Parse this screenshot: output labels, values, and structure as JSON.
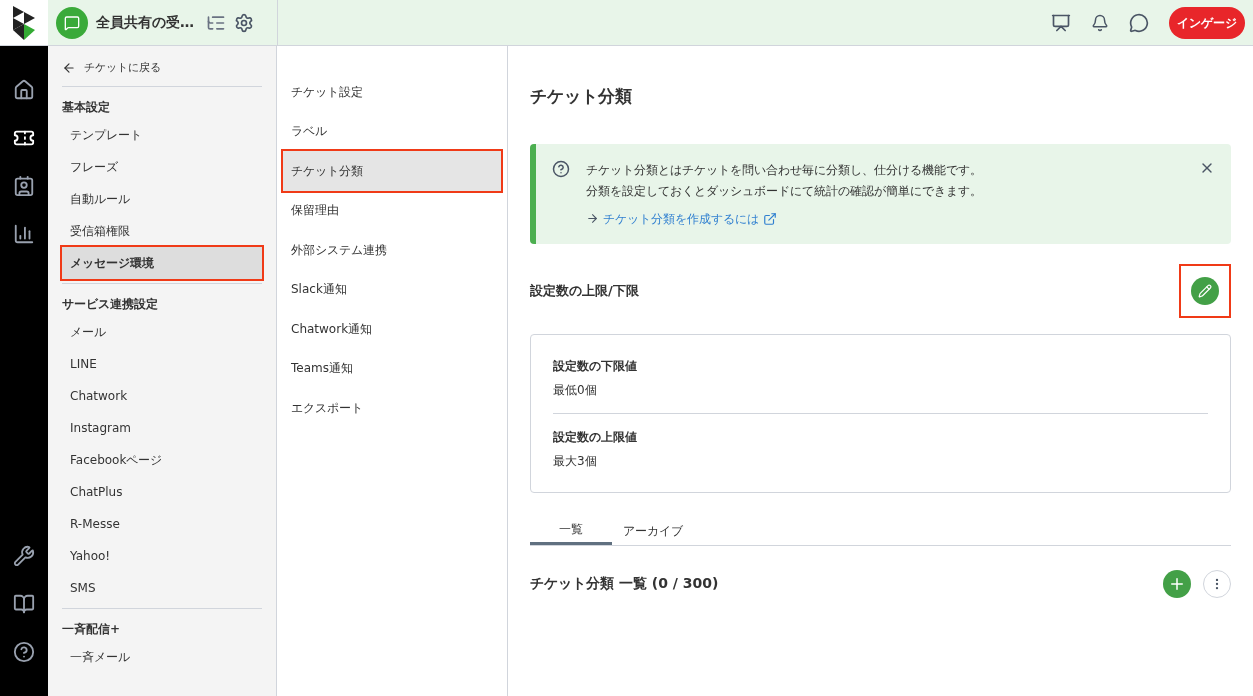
{
  "header": {
    "inbox_name": "全員共有の受…",
    "avatar": "インゲージ"
  },
  "rail": {
    "top": [
      {
        "kind": "home",
        "selected": false
      },
      {
        "kind": "ticket",
        "selected": true
      },
      {
        "kind": "contacts",
        "selected": false
      },
      {
        "kind": "stats",
        "selected": false
      }
    ],
    "bottom": [
      {
        "kind": "tools"
      },
      {
        "kind": "book"
      },
      {
        "kind": "help"
      }
    ]
  },
  "sidebar": {
    "back": "チケットに戻る",
    "sections": [
      {
        "title": "基本設定",
        "items": [
          {
            "label": "テンプレート",
            "selected": false,
            "highlighted": false
          },
          {
            "label": "フレーズ",
            "selected": false,
            "highlighted": false
          },
          {
            "label": "自動ルール",
            "selected": false,
            "highlighted": false
          },
          {
            "label": "受信箱権限",
            "selected": false,
            "highlighted": false
          },
          {
            "label": "メッセージ環境",
            "selected": true,
            "highlighted": true
          }
        ]
      },
      {
        "title": "サービス連携設定",
        "items": [
          {
            "label": "メール",
            "selected": false,
            "highlighted": false
          },
          {
            "label": "LINE",
            "selected": false,
            "highlighted": false
          },
          {
            "label": "Chatwork",
            "selected": false,
            "highlighted": false
          },
          {
            "label": "Instagram",
            "selected": false,
            "highlighted": false
          },
          {
            "label": "Facebookページ",
            "selected": false,
            "highlighted": false
          },
          {
            "label": "ChatPlus",
            "selected": false,
            "highlighted": false
          },
          {
            "label": "R-Messe",
            "selected": false,
            "highlighted": false
          },
          {
            "label": "Yahoo!",
            "selected": false,
            "highlighted": false
          },
          {
            "label": "SMS",
            "selected": false,
            "highlighted": false
          }
        ]
      },
      {
        "title": "一斉配信+",
        "items": [
          {
            "label": "一斉メール",
            "selected": false,
            "highlighted": false
          }
        ]
      }
    ]
  },
  "submenu": [
    {
      "label": "チケット設定",
      "selected": false,
      "highlighted": false
    },
    {
      "label": "ラベル",
      "selected": false,
      "highlighted": false
    },
    {
      "label": "チケット分類",
      "selected": true,
      "highlighted": true
    },
    {
      "label": "保留理由",
      "selected": false,
      "highlighted": false
    },
    {
      "label": "外部システム連携",
      "selected": false,
      "highlighted": false
    },
    {
      "label": "Slack通知",
      "selected": false,
      "highlighted": false
    },
    {
      "label": "Chatwork通知",
      "selected": false,
      "highlighted": false
    },
    {
      "label": "Teams通知",
      "selected": false,
      "highlighted": false
    },
    {
      "label": "エクスポート",
      "selected": false,
      "highlighted": false
    }
  ],
  "main": {
    "title": "チケット分類",
    "notice": {
      "lines": [
        "チケット分類とはチケットを問い合わせ毎に分類し、仕分ける機能です。",
        "分類を設定しておくとダッシュボードにて統計の確認が簡単にできます。"
      ],
      "link": "チケット分類を作成するには"
    },
    "limits": {
      "title": "設定数の上限/下限",
      "edit_highlighted": true,
      "rows": [
        {
          "label": "設定数の下限値",
          "value": "最低0個"
        },
        {
          "label": "設定数の上限値",
          "value": "最大3個"
        }
      ]
    },
    "tabs": [
      {
        "label": "一覧",
        "selected": true
      },
      {
        "label": "アーカイブ",
        "selected": false
      }
    ],
    "list_title": "チケット分類 一覧 (0 / 300)"
  }
}
